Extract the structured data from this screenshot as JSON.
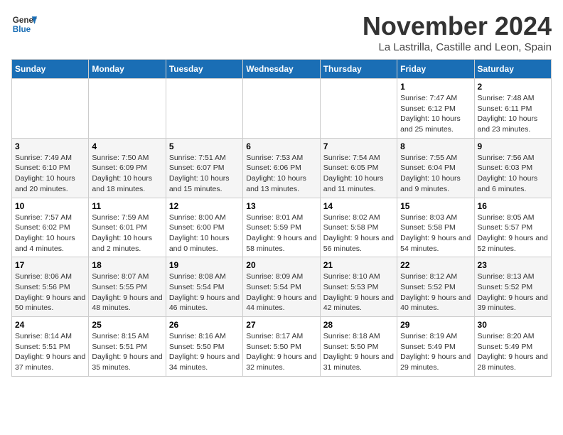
{
  "header": {
    "logo_line1": "General",
    "logo_line2": "Blue",
    "month": "November 2024",
    "location": "La Lastrilla, Castille and Leon, Spain"
  },
  "weekdays": [
    "Sunday",
    "Monday",
    "Tuesday",
    "Wednesday",
    "Thursday",
    "Friday",
    "Saturday"
  ],
  "weeks": [
    [
      {
        "day": "",
        "info": ""
      },
      {
        "day": "",
        "info": ""
      },
      {
        "day": "",
        "info": ""
      },
      {
        "day": "",
        "info": ""
      },
      {
        "day": "",
        "info": ""
      },
      {
        "day": "1",
        "info": "Sunrise: 7:47 AM\nSunset: 6:12 PM\nDaylight: 10 hours and 25 minutes."
      },
      {
        "day": "2",
        "info": "Sunrise: 7:48 AM\nSunset: 6:11 PM\nDaylight: 10 hours and 23 minutes."
      }
    ],
    [
      {
        "day": "3",
        "info": "Sunrise: 7:49 AM\nSunset: 6:10 PM\nDaylight: 10 hours and 20 minutes."
      },
      {
        "day": "4",
        "info": "Sunrise: 7:50 AM\nSunset: 6:09 PM\nDaylight: 10 hours and 18 minutes."
      },
      {
        "day": "5",
        "info": "Sunrise: 7:51 AM\nSunset: 6:07 PM\nDaylight: 10 hours and 15 minutes."
      },
      {
        "day": "6",
        "info": "Sunrise: 7:53 AM\nSunset: 6:06 PM\nDaylight: 10 hours and 13 minutes."
      },
      {
        "day": "7",
        "info": "Sunrise: 7:54 AM\nSunset: 6:05 PM\nDaylight: 10 hours and 11 minutes."
      },
      {
        "day": "8",
        "info": "Sunrise: 7:55 AM\nSunset: 6:04 PM\nDaylight: 10 hours and 9 minutes."
      },
      {
        "day": "9",
        "info": "Sunrise: 7:56 AM\nSunset: 6:03 PM\nDaylight: 10 hours and 6 minutes."
      }
    ],
    [
      {
        "day": "10",
        "info": "Sunrise: 7:57 AM\nSunset: 6:02 PM\nDaylight: 10 hours and 4 minutes."
      },
      {
        "day": "11",
        "info": "Sunrise: 7:59 AM\nSunset: 6:01 PM\nDaylight: 10 hours and 2 minutes."
      },
      {
        "day": "12",
        "info": "Sunrise: 8:00 AM\nSunset: 6:00 PM\nDaylight: 10 hours and 0 minutes."
      },
      {
        "day": "13",
        "info": "Sunrise: 8:01 AM\nSunset: 5:59 PM\nDaylight: 9 hours and 58 minutes."
      },
      {
        "day": "14",
        "info": "Sunrise: 8:02 AM\nSunset: 5:58 PM\nDaylight: 9 hours and 56 minutes."
      },
      {
        "day": "15",
        "info": "Sunrise: 8:03 AM\nSunset: 5:58 PM\nDaylight: 9 hours and 54 minutes."
      },
      {
        "day": "16",
        "info": "Sunrise: 8:05 AM\nSunset: 5:57 PM\nDaylight: 9 hours and 52 minutes."
      }
    ],
    [
      {
        "day": "17",
        "info": "Sunrise: 8:06 AM\nSunset: 5:56 PM\nDaylight: 9 hours and 50 minutes."
      },
      {
        "day": "18",
        "info": "Sunrise: 8:07 AM\nSunset: 5:55 PM\nDaylight: 9 hours and 48 minutes."
      },
      {
        "day": "19",
        "info": "Sunrise: 8:08 AM\nSunset: 5:54 PM\nDaylight: 9 hours and 46 minutes."
      },
      {
        "day": "20",
        "info": "Sunrise: 8:09 AM\nSunset: 5:54 PM\nDaylight: 9 hours and 44 minutes."
      },
      {
        "day": "21",
        "info": "Sunrise: 8:10 AM\nSunset: 5:53 PM\nDaylight: 9 hours and 42 minutes."
      },
      {
        "day": "22",
        "info": "Sunrise: 8:12 AM\nSunset: 5:52 PM\nDaylight: 9 hours and 40 minutes."
      },
      {
        "day": "23",
        "info": "Sunrise: 8:13 AM\nSunset: 5:52 PM\nDaylight: 9 hours and 39 minutes."
      }
    ],
    [
      {
        "day": "24",
        "info": "Sunrise: 8:14 AM\nSunset: 5:51 PM\nDaylight: 9 hours and 37 minutes."
      },
      {
        "day": "25",
        "info": "Sunrise: 8:15 AM\nSunset: 5:51 PM\nDaylight: 9 hours and 35 minutes."
      },
      {
        "day": "26",
        "info": "Sunrise: 8:16 AM\nSunset: 5:50 PM\nDaylight: 9 hours and 34 minutes."
      },
      {
        "day": "27",
        "info": "Sunrise: 8:17 AM\nSunset: 5:50 PM\nDaylight: 9 hours and 32 minutes."
      },
      {
        "day": "28",
        "info": "Sunrise: 8:18 AM\nSunset: 5:50 PM\nDaylight: 9 hours and 31 minutes."
      },
      {
        "day": "29",
        "info": "Sunrise: 8:19 AM\nSunset: 5:49 PM\nDaylight: 9 hours and 29 minutes."
      },
      {
        "day": "30",
        "info": "Sunrise: 8:20 AM\nSunset: 5:49 PM\nDaylight: 9 hours and 28 minutes."
      }
    ]
  ]
}
